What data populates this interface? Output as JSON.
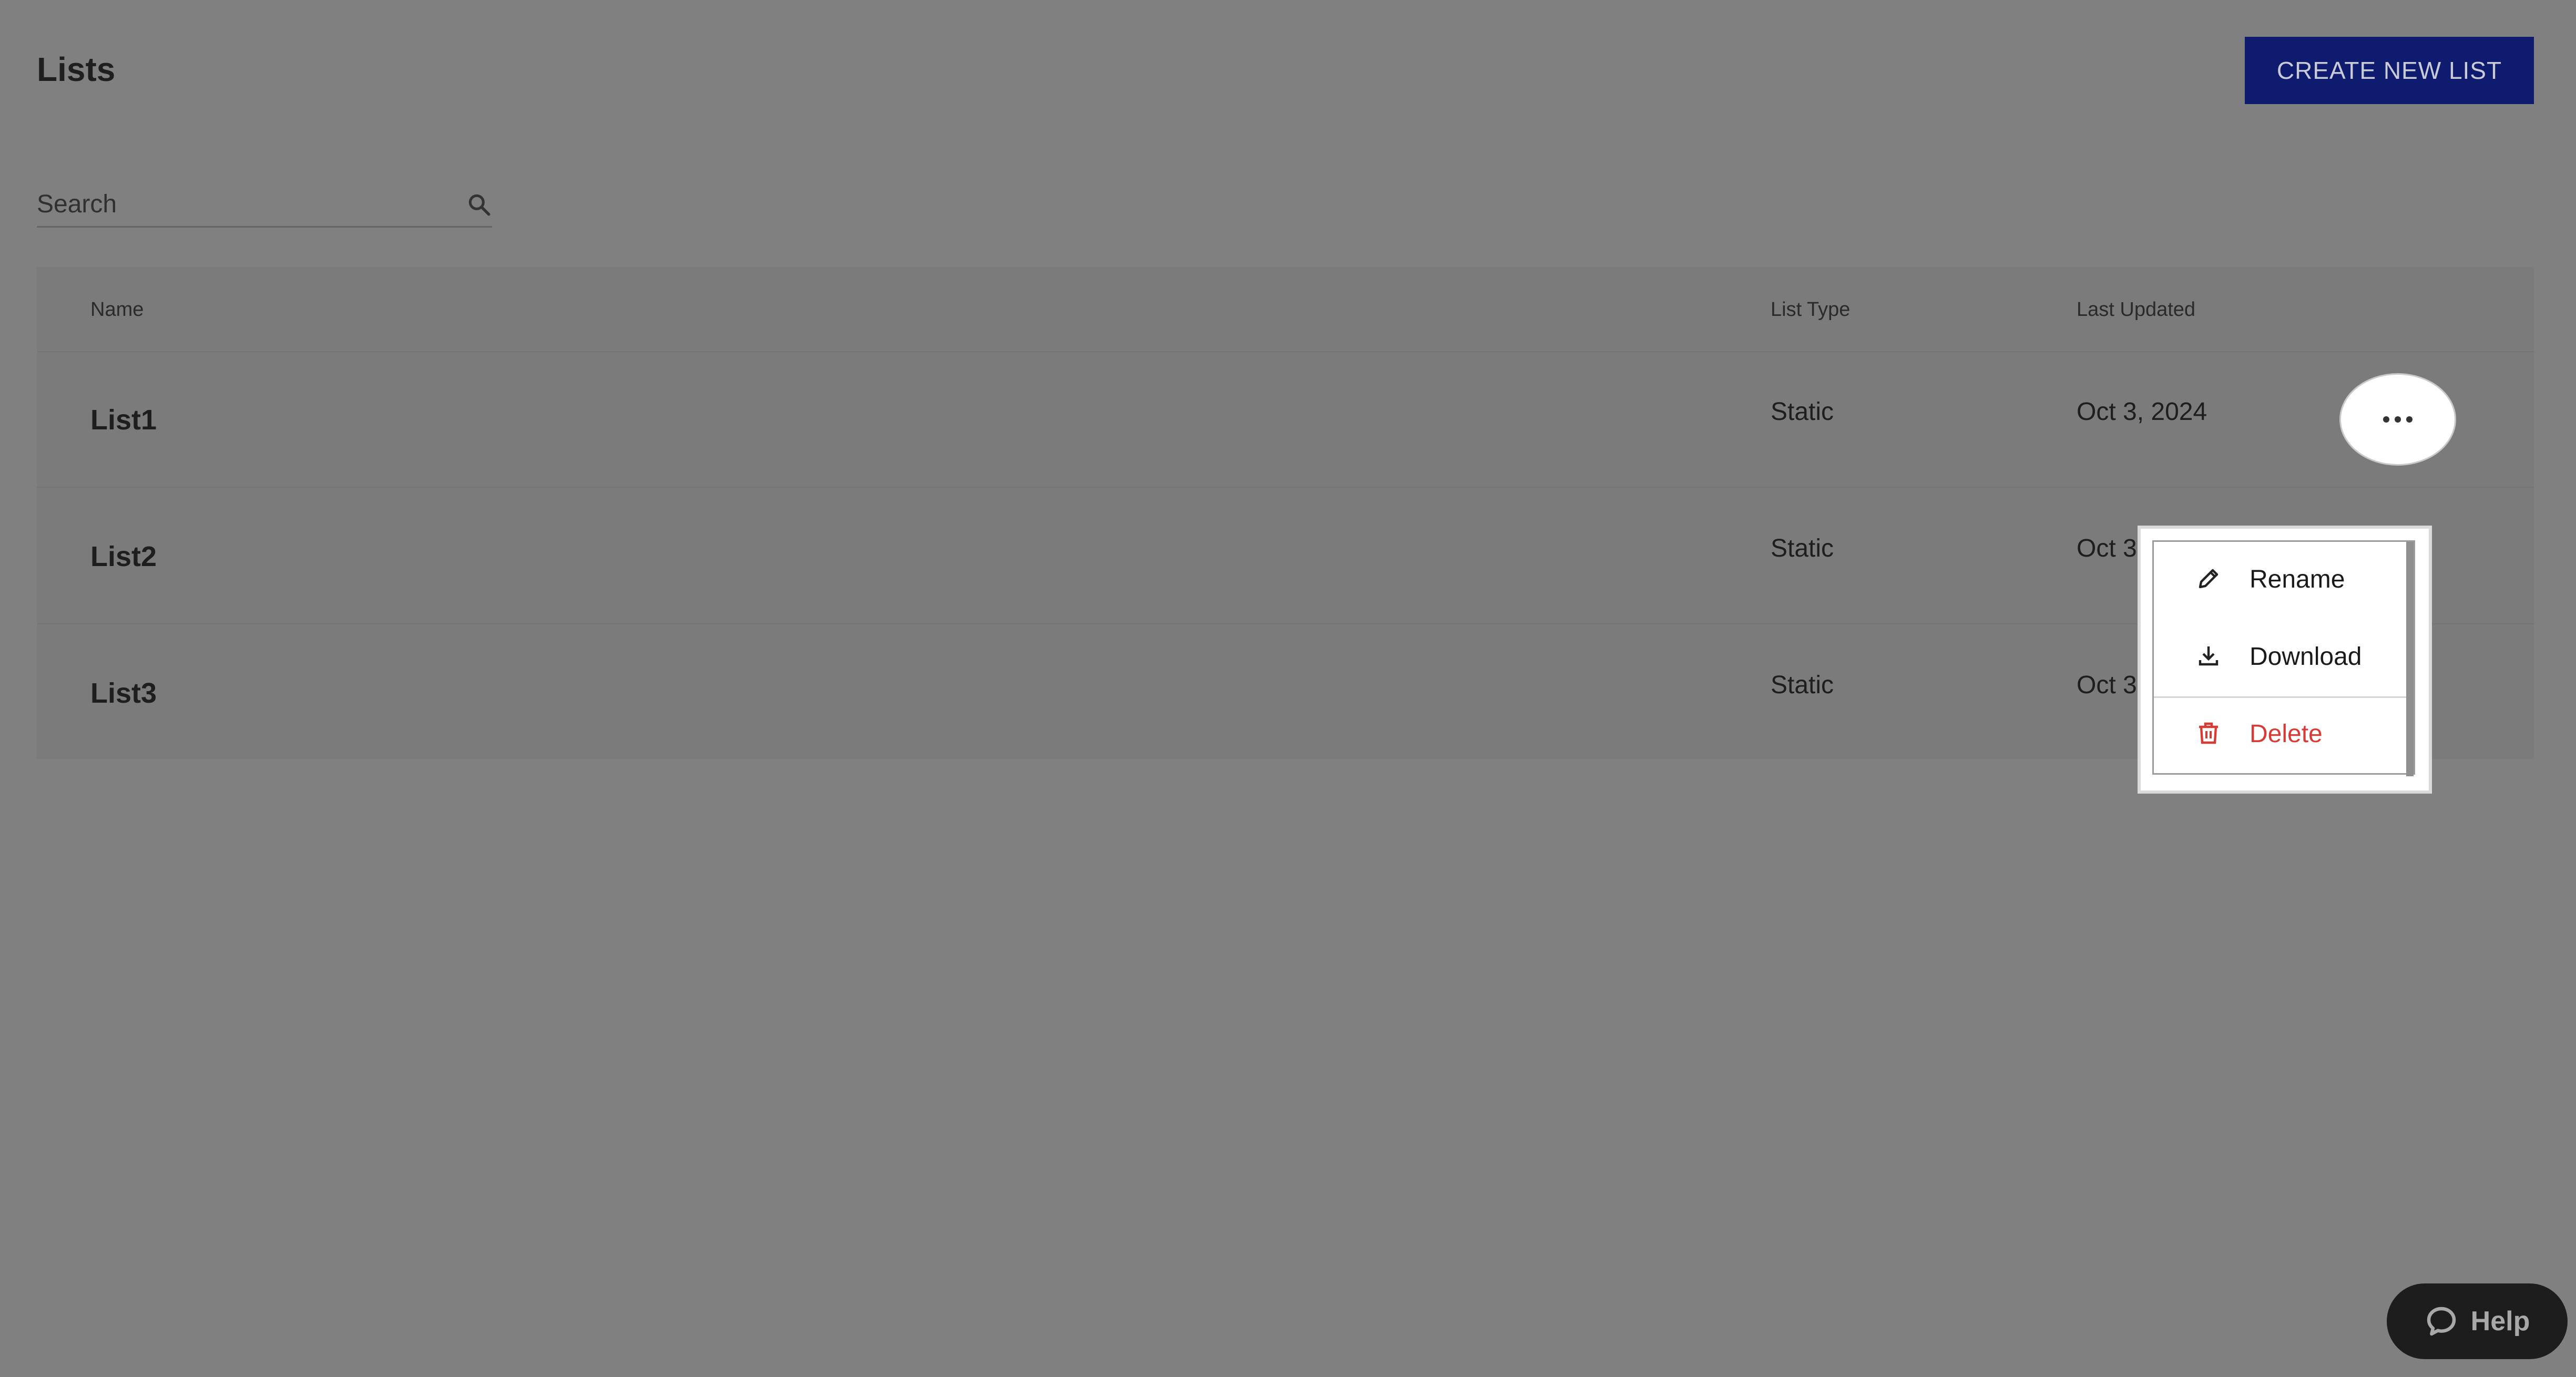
{
  "header": {
    "title": "Lists",
    "create_button_label": "CREATE NEW LIST"
  },
  "search": {
    "placeholder": "Search",
    "icon": "search-icon"
  },
  "table": {
    "columns": [
      "Name",
      "List Type",
      "Last Updated"
    ],
    "rows": [
      {
        "name": "List1",
        "type": "Static",
        "updated": "Oct 3, 2024"
      },
      {
        "name": "List2",
        "type": "Static",
        "updated": "Oct 3,"
      },
      {
        "name": "List3",
        "type": "Static",
        "updated": "Oct 3,"
      }
    ]
  },
  "row_actions": {
    "more_icon": "more-horizontal-icon"
  },
  "context_menu": {
    "items": [
      {
        "label": "Rename",
        "icon": "pencil-icon"
      },
      {
        "label": "Download",
        "icon": "download-icon"
      },
      {
        "label": "Delete",
        "icon": "trash-icon"
      }
    ]
  },
  "help": {
    "label": "Help",
    "icon": "chat-bubble-icon"
  },
  "colors": {
    "overlay_background": "#808080",
    "primary_button": "#0f1b6e",
    "delete_text": "#d93a33",
    "help_button": "#1d1d1d"
  }
}
